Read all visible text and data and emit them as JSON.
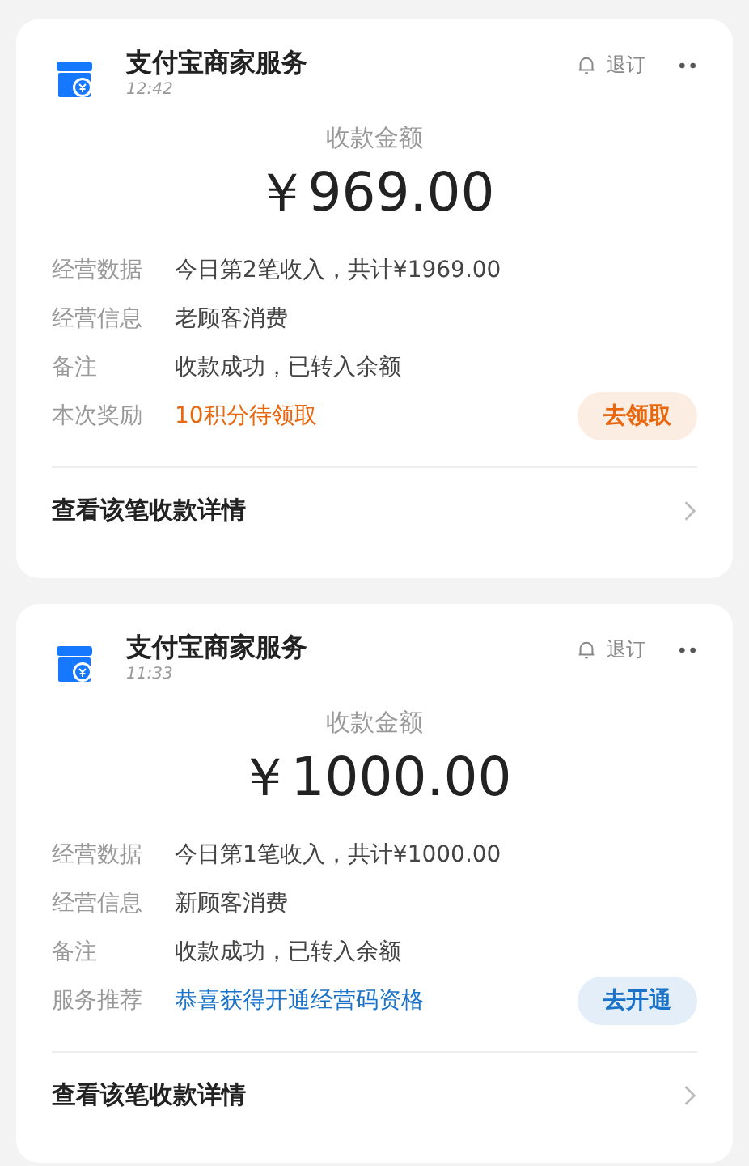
{
  "cards": [
    {
      "service": "支付宝商家服务",
      "time": "12:42",
      "unsubscribe": "退订",
      "amount_label": "收款金额",
      "amount": "￥969.00",
      "rows": [
        {
          "label": "经营数据",
          "value": "今日第2笔收入，共计¥1969.00"
        },
        {
          "label": "经营信息",
          "value": "老顾客消费"
        },
        {
          "label": "备注",
          "value": "收款成功，已转入余额"
        },
        {
          "label": "本次奖励",
          "value": "10积分待领取",
          "color": "#e8670f",
          "action": "去领取"
        }
      ],
      "footer": "查看该笔收款详情"
    },
    {
      "service": "支付宝商家服务",
      "time": "11:33",
      "unsubscribe": "退订",
      "amount_label": "收款金额",
      "amount": "￥1000.00",
      "rows": [
        {
          "label": "经营数据",
          "value": "今日第1笔收入，共计¥1000.00"
        },
        {
          "label": "经营信息",
          "value": "新顾客消费"
        },
        {
          "label": "备注",
          "value": "收款成功，已转入余额"
        },
        {
          "label": "服务推荐",
          "value": "恭喜获得开通经营码资格",
          "color": "#1a73c8",
          "action": "去开通"
        }
      ],
      "footer": "查看该笔收款详情"
    }
  ]
}
